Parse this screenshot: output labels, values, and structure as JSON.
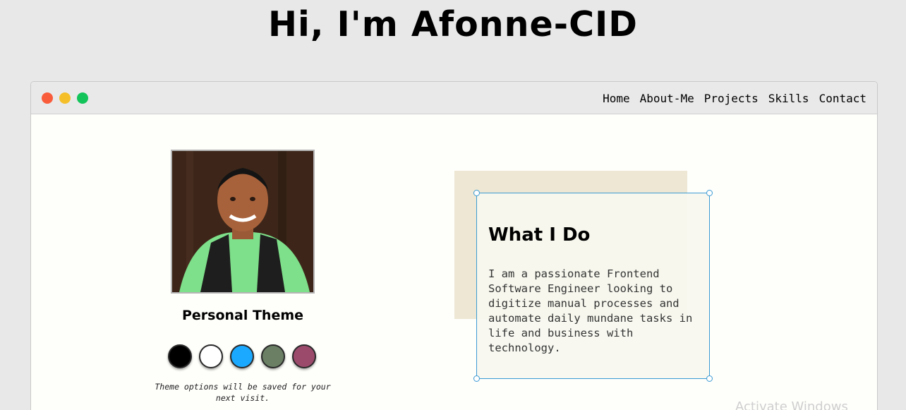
{
  "header": {
    "title": "Hi, I'm Afonne-CID"
  },
  "window": {
    "controls": [
      {
        "name": "close",
        "color": "#f95c3b"
      },
      {
        "name": "minimize",
        "color": "#f4bf29"
      },
      {
        "name": "maximize",
        "color": "#13c45a"
      }
    ],
    "nav": [
      {
        "label": "Home"
      },
      {
        "label": "About-Me"
      },
      {
        "label": "Projects"
      },
      {
        "label": "Skills"
      },
      {
        "label": "Contact"
      }
    ]
  },
  "profile": {
    "photo_icon": "profile-photo",
    "theme_title": "Personal Theme",
    "theme_swatches": [
      {
        "name": "black",
        "color": "#000000"
      },
      {
        "name": "white",
        "color": "#ffffff"
      },
      {
        "name": "blue",
        "color": "#1aa9ff"
      },
      {
        "name": "green",
        "color": "#6a7f64"
      },
      {
        "name": "plum",
        "color": "#9c4a6b"
      }
    ],
    "theme_note": "Theme options will be saved for your next visit."
  },
  "what_i_do": {
    "title": "What I Do",
    "text": "I am a passionate Frontend Software Engineer looking to digitize manual processes and automate daily mundane tasks in life and business with technology."
  },
  "watermark": "Activate Windows"
}
